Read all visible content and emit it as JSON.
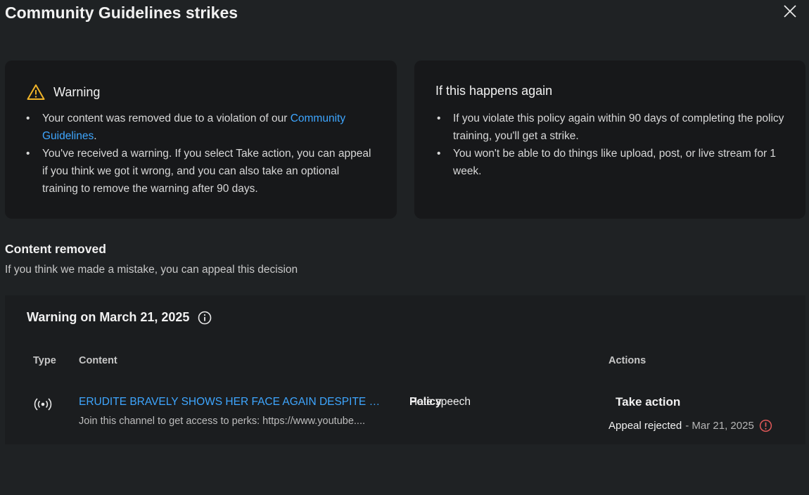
{
  "dialog": {
    "title": "Community Guidelines strikes"
  },
  "icons": {
    "close": "close-icon",
    "warning": "warning-icon",
    "info": "info-icon",
    "live": "live-broadcast-icon",
    "error_info": "error-info-icon"
  },
  "colors": {
    "link": "#3ea6ff",
    "warning_icon": "#f0b429",
    "error_icon": "#e05858"
  },
  "warning_card": {
    "heading": "Warning",
    "bullet1_text": "Your content was removed due to a violation of our ",
    "bullet1_link": "Community Guidelines",
    "bullet1_end": ".",
    "bullet2": "You've received a warning. If you select Take action, you can appeal if you think we got it wrong, and you can also take an optional training to remove the warning after 90 days."
  },
  "again_card": {
    "heading": "If this happens again",
    "bullets": [
      "If you violate this policy again within 90 days of completing the policy training, you'll get a strike.",
      "You won't be able to do things like upload, post, or live stream for 1 week."
    ]
  },
  "content_removed": {
    "title": "Content removed",
    "subtitle": "If you think we made a mistake, you can appeal this decision"
  },
  "warning_entry": {
    "heading": "Warning on March 21, 2025",
    "columns": {
      "type": "Type",
      "content": "Content",
      "policy": "Policy",
      "actions": "Actions"
    },
    "row": {
      "content_title": "ERUDITE BRAVELY SHOWS HER FACE AGAIN DESPITE BEI...",
      "content_desc": "Join this channel to get access to perks: https://www.youtube....",
      "policy": "Hate speech",
      "action_label": "Take action",
      "appeal_status": "Appeal rejected",
      "appeal_date": "- Mar 21, 2025"
    }
  }
}
